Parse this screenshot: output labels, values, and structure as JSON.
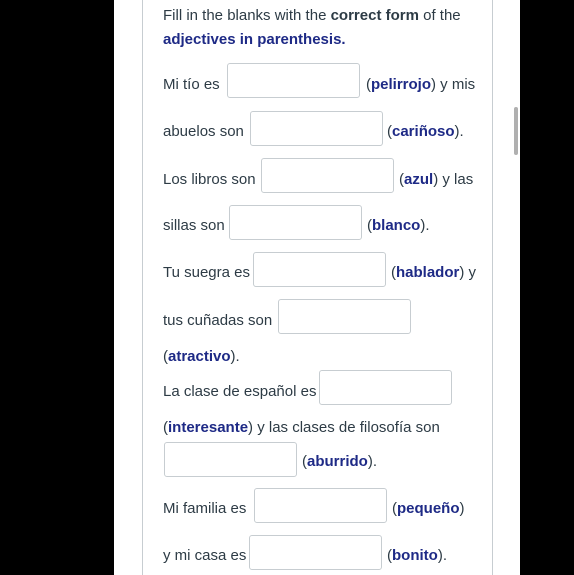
{
  "instructions": {
    "part1": "Fill in the blanks with the ",
    "bold": "correct form",
    "part2": " of the",
    "blue": "adjectives in parenthesis."
  },
  "items": [
    {
      "before": "Mi tío es",
      "adjective": "pelirrojo",
      "after": ") y mis",
      "value": ""
    },
    {
      "before": "abuelos son",
      "adjective": "cariñoso",
      "after": ").",
      "value": ""
    },
    {
      "before": "Los libros son",
      "adjective": "azul",
      "after": ") y las",
      "value": ""
    },
    {
      "before": "sillas son",
      "adjective": "blanco",
      "after": ").",
      "value": ""
    },
    {
      "before": "Tu suegra es",
      "adjective": "hablador",
      "after": ") y",
      "value": ""
    },
    {
      "before": "tus cuñadas son",
      "adjective": "atractivo",
      "after": ").",
      "value": ""
    },
    {
      "before": "La clase de español es",
      "adjective": "interesante",
      "after": ") y las clases de filosofía son",
      "value": ""
    },
    {
      "before": "",
      "adjective": "aburrido",
      "after": ").",
      "value": ""
    },
    {
      "before": "Mi familia es",
      "adjective": "pequeño",
      "after": ")",
      "value": ""
    },
    {
      "before": "y mi casa es",
      "adjective": "bonito",
      "after": ").",
      "value": ""
    }
  ],
  "open_paren": "("
}
